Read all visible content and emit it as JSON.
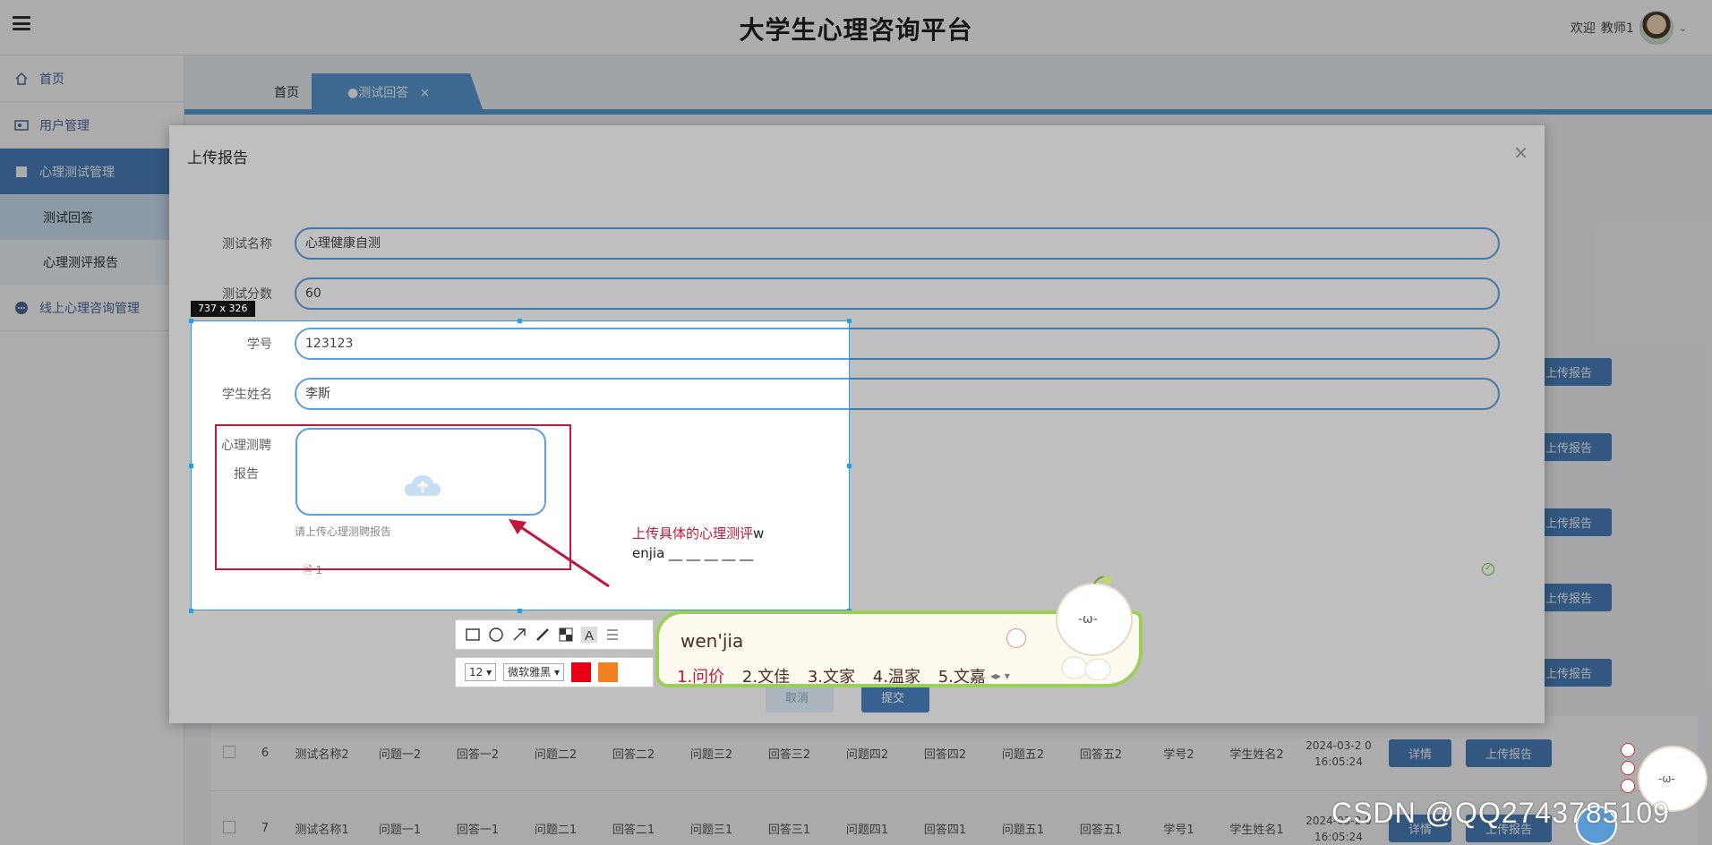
{
  "header": {
    "title": "大学生心理咨询平台",
    "welcome": "欢迎",
    "username": "教师1"
  },
  "sidebar": {
    "items": [
      {
        "label": "首页"
      },
      {
        "label": "用户管理"
      },
      {
        "label": "心理测试管理"
      },
      {
        "label": "测试回答"
      },
      {
        "label": "心理测评报告"
      },
      {
        "label": "线上心理咨询管理"
      }
    ]
  },
  "tabs": {
    "home": "首页",
    "current": "●测试回答",
    "close": "×"
  },
  "table": {
    "rows": [
      {
        "idx": "6",
        "cells": [
          "测试名称2",
          "问题一2",
          "回答一2",
          "问题二2",
          "回答二2",
          "问题三2",
          "回答三2",
          "问题四2",
          "回答四2",
          "问题五2",
          "回答五2",
          "学号2",
          "学生姓名2"
        ],
        "date": "2024-03-2 0 16:05:24",
        "detail": "详情",
        "upload": "上传报告"
      },
      {
        "idx": "7",
        "cells": [
          "测试名称1",
          "问题一1",
          "回答一1",
          "问题二1",
          "回答二1",
          "问题三1",
          "回答三1",
          "问题四1",
          "回答四1",
          "问题五1",
          "回答五1",
          "学号1",
          "学生姓名1"
        ],
        "date": "2024-03-2 0 16:05:24",
        "detail": "详情",
        "upload": "上传报告"
      }
    ],
    "right_upload_labels": [
      "上传报告",
      "上传报告",
      "上传报告",
      "上传报告",
      "上传报告"
    ]
  },
  "dialog": {
    "title": "上传报告",
    "close": "×",
    "fields": [
      {
        "label": "测试名称",
        "value": "心理健康自测"
      },
      {
        "label": "测试分数",
        "value": "60"
      },
      {
        "label": "学号",
        "value": "123123"
      },
      {
        "label": "学生姓名",
        "value": "李斯"
      }
    ],
    "upload_label": "心理测聘报告",
    "upload_tip": "请上传心理测聘报告",
    "file_name": "1",
    "cancel": "取消",
    "submit": "提交"
  },
  "screenshot_tool": {
    "size_label": "737 x 326",
    "annotation_line1_red": "上传具体的心理测评",
    "annotation_line1_rest": "w",
    "annotation_line2": "enjia __ __ __ __ __",
    "font_size": "12",
    "font_name": "微软雅黑"
  },
  "ime": {
    "input": "wen'jia",
    "candidates": [
      "1.问价",
      "2.文佳",
      "3.文家",
      "4.温家",
      "5.文嘉"
    ]
  },
  "watermark": "CSDN @QQ2743785109",
  "colors": {
    "accent": "#4a82be",
    "input_border": "#5aa0dc",
    "annotation_red": "#c0183a",
    "selection_blue": "#1ea0f0",
    "swatch_red": "#e60012",
    "swatch_orange": "#f08020"
  }
}
